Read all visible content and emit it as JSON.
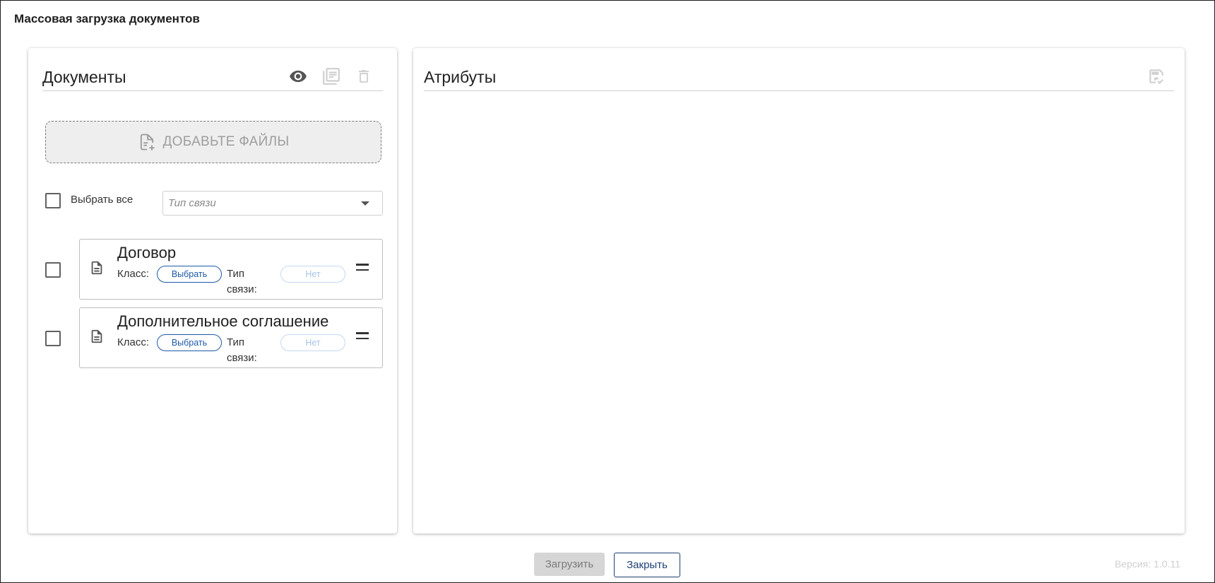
{
  "window": {
    "title": "Массовая загрузка документов"
  },
  "documents_panel": {
    "title": "Документы",
    "icons": [
      "eye-icon",
      "list-document-icon",
      "trash-icon"
    ],
    "add_files_label": "ДОБАВЬТЕ ФАЙЛЫ",
    "select_all_label": "Выбрать все",
    "link_type_placeholder": "Тип связи",
    "items": [
      {
        "title": "Договор",
        "class_label": "Класс:",
        "class_button": "Выбрать",
        "link_type_label": "Тип связи:",
        "link_type_value": "Нет"
      },
      {
        "title": "Дополнительное соглашение",
        "class_label": "Класс:",
        "class_button": "Выбрать",
        "link_type_label": "Тип связи:",
        "link_type_value": "Нет"
      }
    ]
  },
  "attributes_panel": {
    "title": "Атрибуты",
    "icons": [
      "save-icon"
    ]
  },
  "footer": {
    "upload_label": "Загрузить",
    "close_label": "Закрыть",
    "version": "Версия: 1.0.11"
  },
  "colors": {
    "accent_blue": "#1e5aa8",
    "close_border": "#1e3f73",
    "disabled_gray": "#d6d6d6"
  }
}
